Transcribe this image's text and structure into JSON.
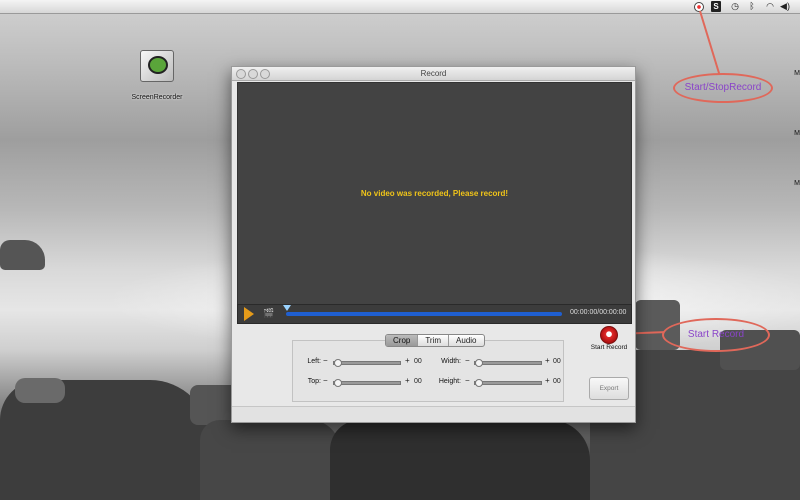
{
  "menubar": {
    "icons": [
      "record-status-icon",
      "script-icon",
      "time-machine-icon",
      "bluetooth-icon",
      "wifi-icon",
      "volume-icon"
    ]
  },
  "desktop": {
    "icon_label": "ScreenRecorder",
    "edge_letters": [
      "M",
      "M",
      "M"
    ]
  },
  "annotations": {
    "top": "Start/StopRecord",
    "bottom": "Start Record"
  },
  "window": {
    "title": "Record",
    "message": "No video was recorded, Please record!",
    "time": "00:00:00/00:00:00",
    "tabs": [
      {
        "label": "Crop",
        "selected": true
      },
      {
        "label": "Trim",
        "selected": false
      },
      {
        "label": "Audio",
        "selected": false
      }
    ],
    "crop": {
      "left_label": "Left:",
      "left_value": "00",
      "top_label": "Top:",
      "top_value": "00",
      "width_label": "Width:",
      "width_value": "00",
      "height_label": "Height:",
      "height_value": "00",
      "minus": "−",
      "plus": "+"
    },
    "start_record_label": "Start Record",
    "export_label": "Export"
  },
  "colors": {
    "accent_message": "#f0c419",
    "annotation_outline": "#e0685a",
    "annotation_text": "#8a44c9",
    "progress_track": "#1f5fd1",
    "record_red": "#e02a2a"
  }
}
